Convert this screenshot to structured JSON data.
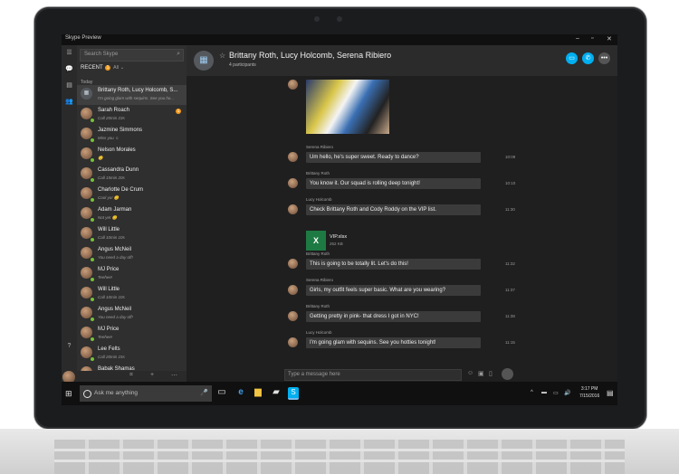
{
  "window": {
    "title": "Skype Preview",
    "controls": [
      "–",
      "▫",
      "✕"
    ]
  },
  "sidebar_icons": [
    "☰",
    "💬",
    "▤",
    "👥",
    "?"
  ],
  "contacts": {
    "search_placeholder": "Search Skype",
    "recent_label": "RECENT",
    "recent_badge": "1",
    "filter_label": "All ⌄",
    "today_label": "Today",
    "items": [
      {
        "name": "Brittany Roth, Lucy Holcomb, S...",
        "sub": "I'm going glam with sequins. See you ho...",
        "group": true,
        "selected": true
      },
      {
        "name": "Sarah Roach",
        "sub": "Call 20min 23s",
        "badge": "1"
      },
      {
        "name": "Jazmine Simmons",
        "sub": "Miss you ☺"
      },
      {
        "name": "Nelson Morales",
        "sub": "😊"
      },
      {
        "name": "Cassandra Dunn",
        "sub": "Call 15min 20s"
      },
      {
        "name": "Charlotte De Crum",
        "sub": "Cool yo! 😊"
      },
      {
        "name": "Adam Jarman",
        "sub": "Not yet 😊"
      },
      {
        "name": "Will Little",
        "sub": "Call 10min 10s"
      },
      {
        "name": "Angus McNeil",
        "sub": "You need a day off!"
      },
      {
        "name": "MJ Price",
        "sub": "Teehee!"
      },
      {
        "name": "Will Little",
        "sub": "Call 10min 10s"
      },
      {
        "name": "Angus McNeil",
        "sub": "You need a day off!"
      },
      {
        "name": "MJ Price",
        "sub": "Teehee!"
      },
      {
        "name": "Lee Felts",
        "sub": "Call 20min 15s"
      },
      {
        "name": "Babak Shamas",
        "sub": "I must have missed you!"
      }
    ],
    "bottom_icons": [
      "⌗",
      "+",
      "⋯"
    ]
  },
  "chat": {
    "title": "Brittany Roth, Lucy Holcomb, Serena Ribiero",
    "participants": "4 participants",
    "buttons": [
      "▭",
      "✆",
      "•••"
    ],
    "messages": [
      {
        "sender": "Serena Ribiero",
        "text": "Um hello, he's super sweet. Ready to dance?",
        "time": "10:09"
      },
      {
        "sender": "Brittany Roth",
        "text": "You know it. Our squad is rolling deep tonight!",
        "time": "10:10"
      },
      {
        "sender": "Lucy Holcomb",
        "text": "Check Brittany Roth and Cody Roddy on the VIP list.",
        "time": "11:30"
      },
      {
        "sender": "Brittany Roth",
        "text": "This is going to be totally lit. Let's do this!",
        "time": "11:32"
      },
      {
        "sender": "Serena Ribiero",
        "text": "Girls, my outfit feels super basic. What are you wearing?",
        "time": "11:37"
      },
      {
        "sender": "Brittany Roth",
        "text": "Getting pretty in pink- that dress I got in NYC!",
        "time": "11:38"
      },
      {
        "sender": "Lucy Holcomb",
        "text": "I'm going glam with sequins. See you hotties tonight!",
        "time": "11:15"
      }
    ],
    "file": {
      "name": "VIP.xlsx",
      "size": "252 KB",
      "icon": "X"
    },
    "compose_placeholder": "Type a message here",
    "compose_icons": [
      "☺",
      "▣",
      "▯"
    ]
  },
  "taskbar": {
    "search_placeholder": "Ask me anything",
    "apps": [
      "▭",
      "e",
      "▆",
      "▰",
      "S"
    ],
    "tray": [
      "^",
      "▬",
      "▭",
      "🔊",
      "▤"
    ],
    "time": "3:17 PM",
    "date": "7/15/2016",
    "notification_icon": "▤"
  }
}
